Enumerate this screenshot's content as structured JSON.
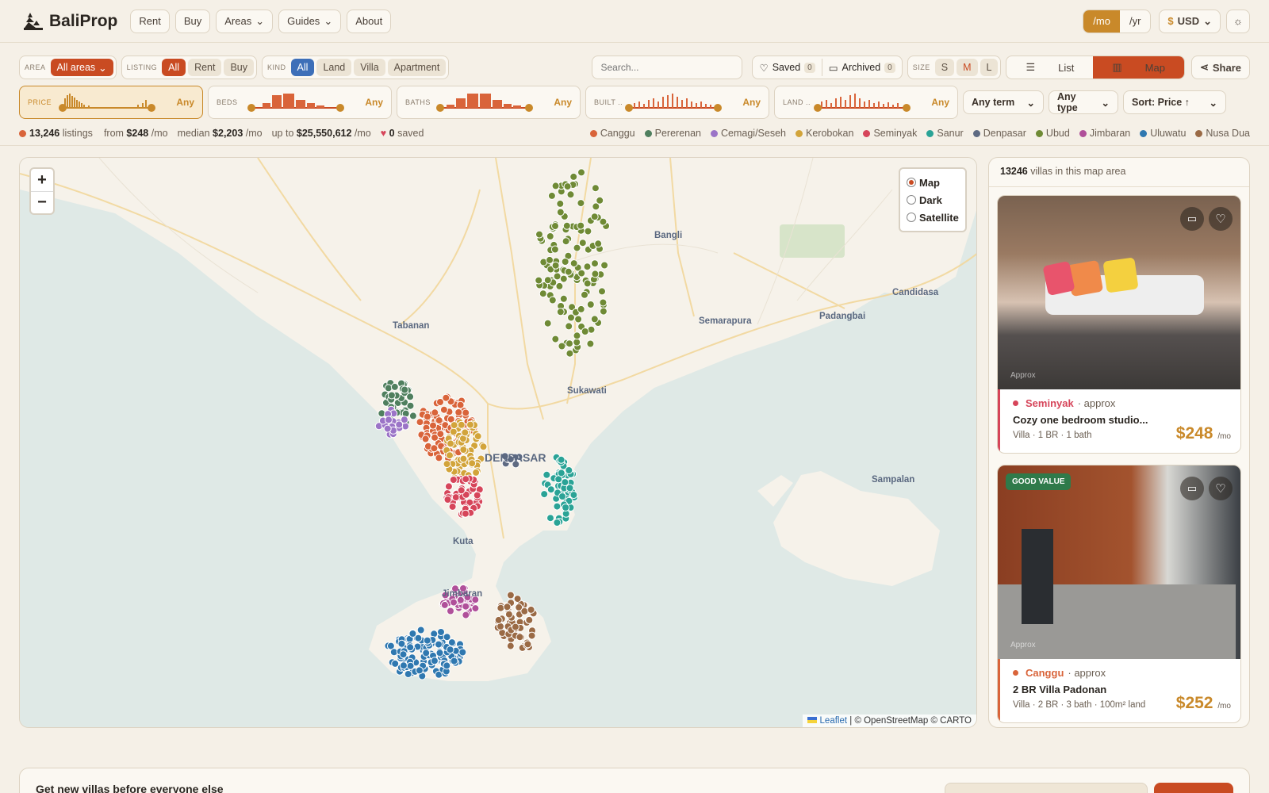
{
  "app": {
    "name": "BaliProp"
  },
  "nav": [
    "Rent",
    "Buy",
    "Areas",
    "Guides",
    "About"
  ],
  "period": {
    "monthly": "/mo",
    "yearly": "/yr",
    "selected": "/mo"
  },
  "currency": {
    "symbol": "$",
    "code": "USD"
  },
  "filters": {
    "area": {
      "label": "AREA",
      "value": "All areas"
    },
    "listing": {
      "label": "LISTING",
      "options": [
        "All",
        "Rent",
        "Buy"
      ],
      "selected": "All"
    },
    "kind": {
      "label": "KIND",
      "options": [
        "All",
        "Land",
        "Villa",
        "Apartment"
      ],
      "selected": "All"
    },
    "search_placeholder": "Search...",
    "saved": {
      "label": "Saved",
      "count": "0"
    },
    "archived": {
      "label": "Archived",
      "count": "0"
    },
    "size": {
      "label": "SIZE",
      "options": [
        "S",
        "M",
        "L"
      ]
    },
    "view": {
      "list": "List",
      "map": "Map",
      "selected": "Map"
    },
    "share": "Share",
    "histograms": [
      {
        "label": "PRICE",
        "value": "Any",
        "active": true
      },
      {
        "label": "BEDS",
        "value": "Any"
      },
      {
        "label": "BATHS",
        "value": "Any"
      },
      {
        "label": "BUILT ..",
        "value": "Any"
      },
      {
        "label": "LAND ..",
        "value": "Any"
      }
    ],
    "term": "Any term",
    "type": "Any type",
    "sort": "Sort: Price ↑"
  },
  "stats": {
    "listings": "13,246",
    "listings_label": "listings",
    "from_label": "from",
    "from": "$248",
    "unit": "/mo",
    "median_label": "median",
    "median": "$2,203",
    "upto_label": "up to",
    "upto": "$25,550,612",
    "saved": "0",
    "saved_label": "saved"
  },
  "areas_legend": [
    {
      "name": "Canggu",
      "color": "#d9643a"
    },
    {
      "name": "Pererenan",
      "color": "#4f7f5e"
    },
    {
      "name": "Cemagi/Seseh",
      "color": "#9b74c7"
    },
    {
      "name": "Kerobokan",
      "color": "#d2a43a"
    },
    {
      "name": "Seminyak",
      "color": "#d6455a"
    },
    {
      "name": "Sanur",
      "color": "#2aa396"
    },
    {
      "name": "Denpasar",
      "color": "#5e6a82"
    },
    {
      "name": "Ubud",
      "color": "#6f8a35"
    },
    {
      "name": "Jimbaran",
      "color": "#b0509a"
    },
    {
      "name": "Uluwatu",
      "color": "#2f78b0"
    },
    {
      "name": "Nusa Dua",
      "color": "#9a6a45"
    }
  ],
  "map": {
    "zoom_in": "+",
    "zoom_out": "−",
    "layers": [
      "Map",
      "Dark",
      "Satellite"
    ],
    "layer_selected": "Map",
    "attribution_link": "Leaflet",
    "attribution_rest": "| © OpenStreetMap © CARTO",
    "places": [
      "Bangli",
      "Candidasa",
      "Tabanan",
      "Semarapura",
      "Padangbai",
      "Sukawati",
      "DENPASAR",
      "Sampalan",
      "Kuta",
      "Jimbaran"
    ]
  },
  "sidebar": {
    "count": "13246",
    "count_label": "villas in this map area",
    "cards": [
      {
        "area": "Seminyak",
        "approx": "· approx",
        "title": "Cozy one bedroom studio...",
        "meta": "Villa · 1 BR · 1 bath",
        "price": "$248",
        "unit": "/mo",
        "badge": "",
        "image_note": "Approx"
      },
      {
        "area": "Canggu",
        "approx": "· approx",
        "title": "2 BR Villa Padonan",
        "meta": "Villa · 2 BR · 3 bath · 100m² land",
        "price": "$252",
        "unit": "/mo",
        "badge": "GOOD VALUE",
        "image_note": "Approx"
      }
    ]
  },
  "newsletter": {
    "title": "Get new villas before everyone else"
  }
}
